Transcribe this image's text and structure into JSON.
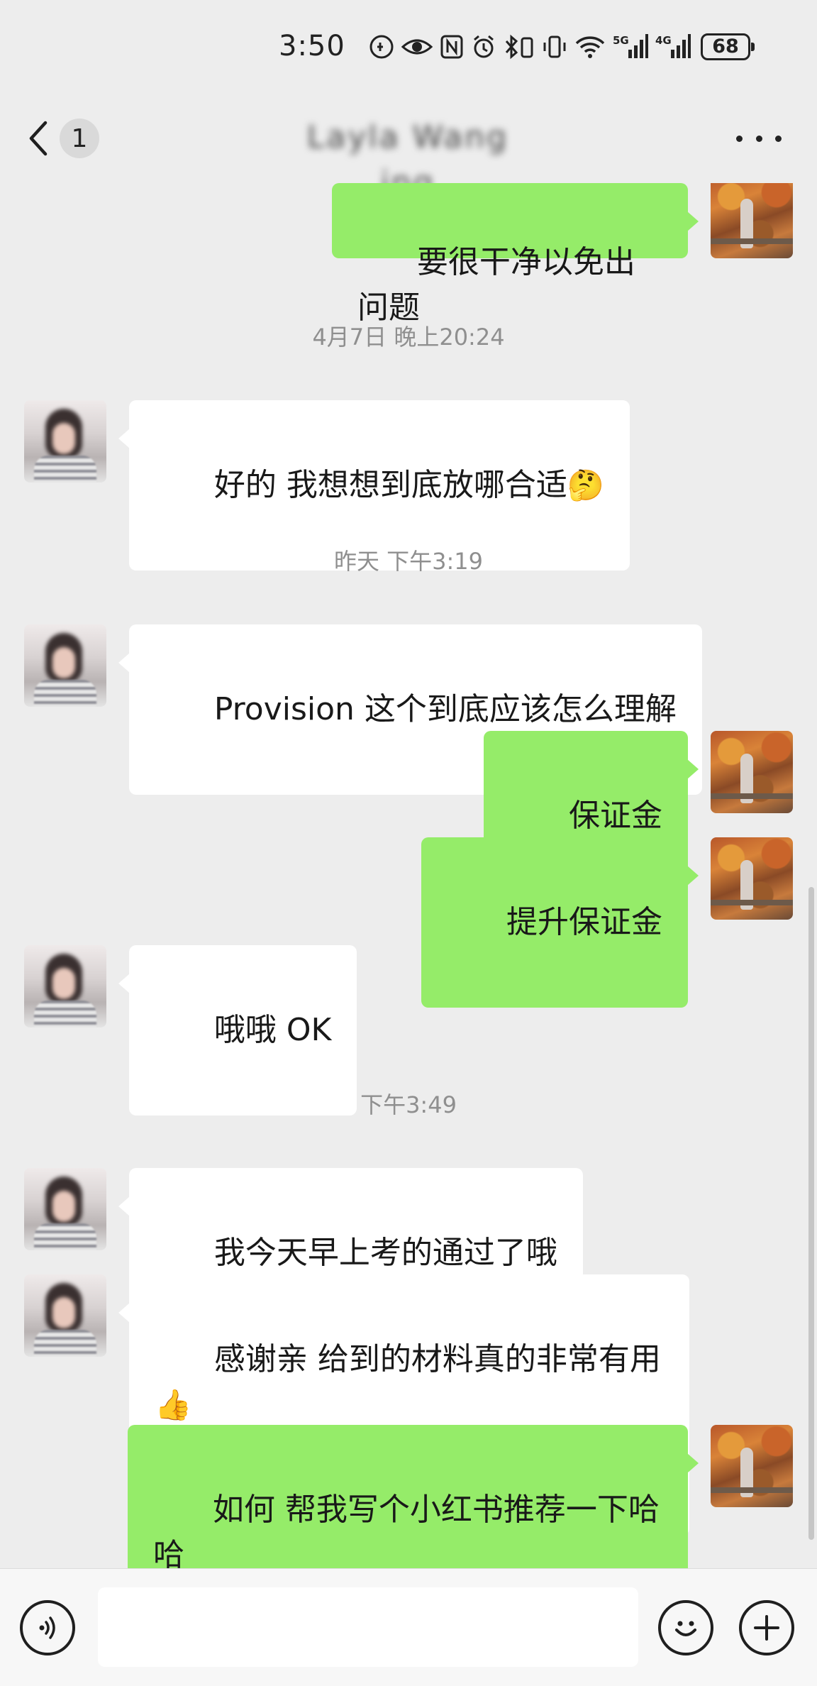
{
  "status_bar": {
    "time": "3:50",
    "network_5g": "5G",
    "network_4g": "4G",
    "battery": "68"
  },
  "header": {
    "back_count": "1",
    "title": "Layla Wang ing",
    "more_icon": "more-icon"
  },
  "messages": [
    {
      "type": "self",
      "text": "要很干净以免出问题"
    },
    {
      "type": "time",
      "text": "4月7日 晚上20:24"
    },
    {
      "type": "other",
      "text": "好的 我想想到底放哪合适",
      "emoji": "🤔"
    },
    {
      "type": "time",
      "text": "昨天 下午3:19"
    },
    {
      "type": "other",
      "text": "Provision 这个到底应该怎么理解"
    },
    {
      "type": "self",
      "text": "保证金"
    },
    {
      "type": "self",
      "text": "提升保证金"
    },
    {
      "type": "other",
      "text": "哦哦 OK"
    },
    {
      "type": "time",
      "text": "下午3:49"
    },
    {
      "type": "other",
      "text": "我今天早上考的通过了哦"
    },
    {
      "type": "other",
      "text": "感谢亲 给到的材料真的非常有用",
      "emoji": "👍",
      "line2": "👍"
    },
    {
      "type": "self",
      "text": "如何 帮我写个小红书推荐一下哈哈",
      "line2": "哈"
    }
  ],
  "input_bar": {
    "voice_icon": "voice-icon",
    "emoji_icon": "emoji-icon",
    "plus_icon": "plus-icon",
    "input_value": ""
  },
  "colors": {
    "background": "#ededed",
    "self_bubble": "#95ec69",
    "other_bubble": "#ffffff",
    "timestamp": "#8f8f8f"
  }
}
